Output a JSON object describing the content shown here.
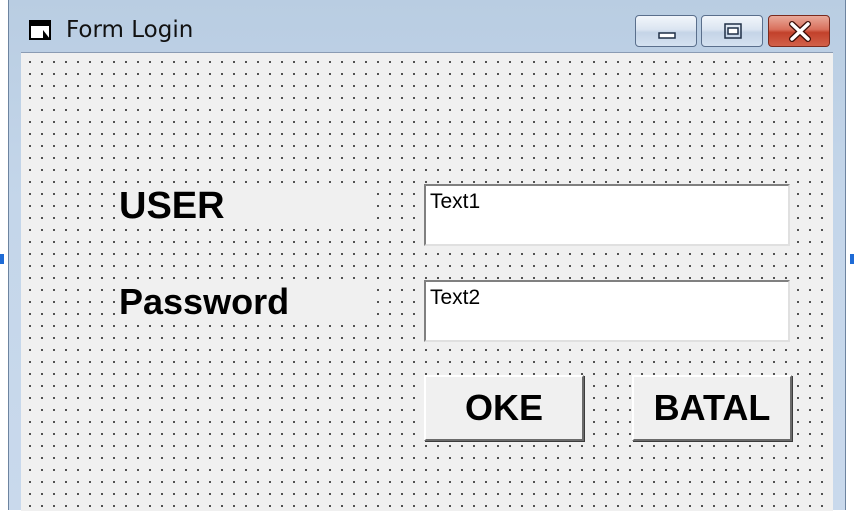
{
  "window": {
    "title": "Form Login",
    "controls": {
      "minimize": "minimize-icon",
      "maximize": "maximize-icon",
      "close": "close-icon"
    }
  },
  "form": {
    "user_label": "USER",
    "password_label": "Password",
    "user_field_value": "Text1",
    "password_field_value": "Text2",
    "ok_button": "OKE",
    "cancel_button": "BATAL"
  },
  "colors": {
    "close_button": "#c2412b",
    "form_background": "#f0f0f0",
    "title_bar": "#c4d6ea"
  }
}
